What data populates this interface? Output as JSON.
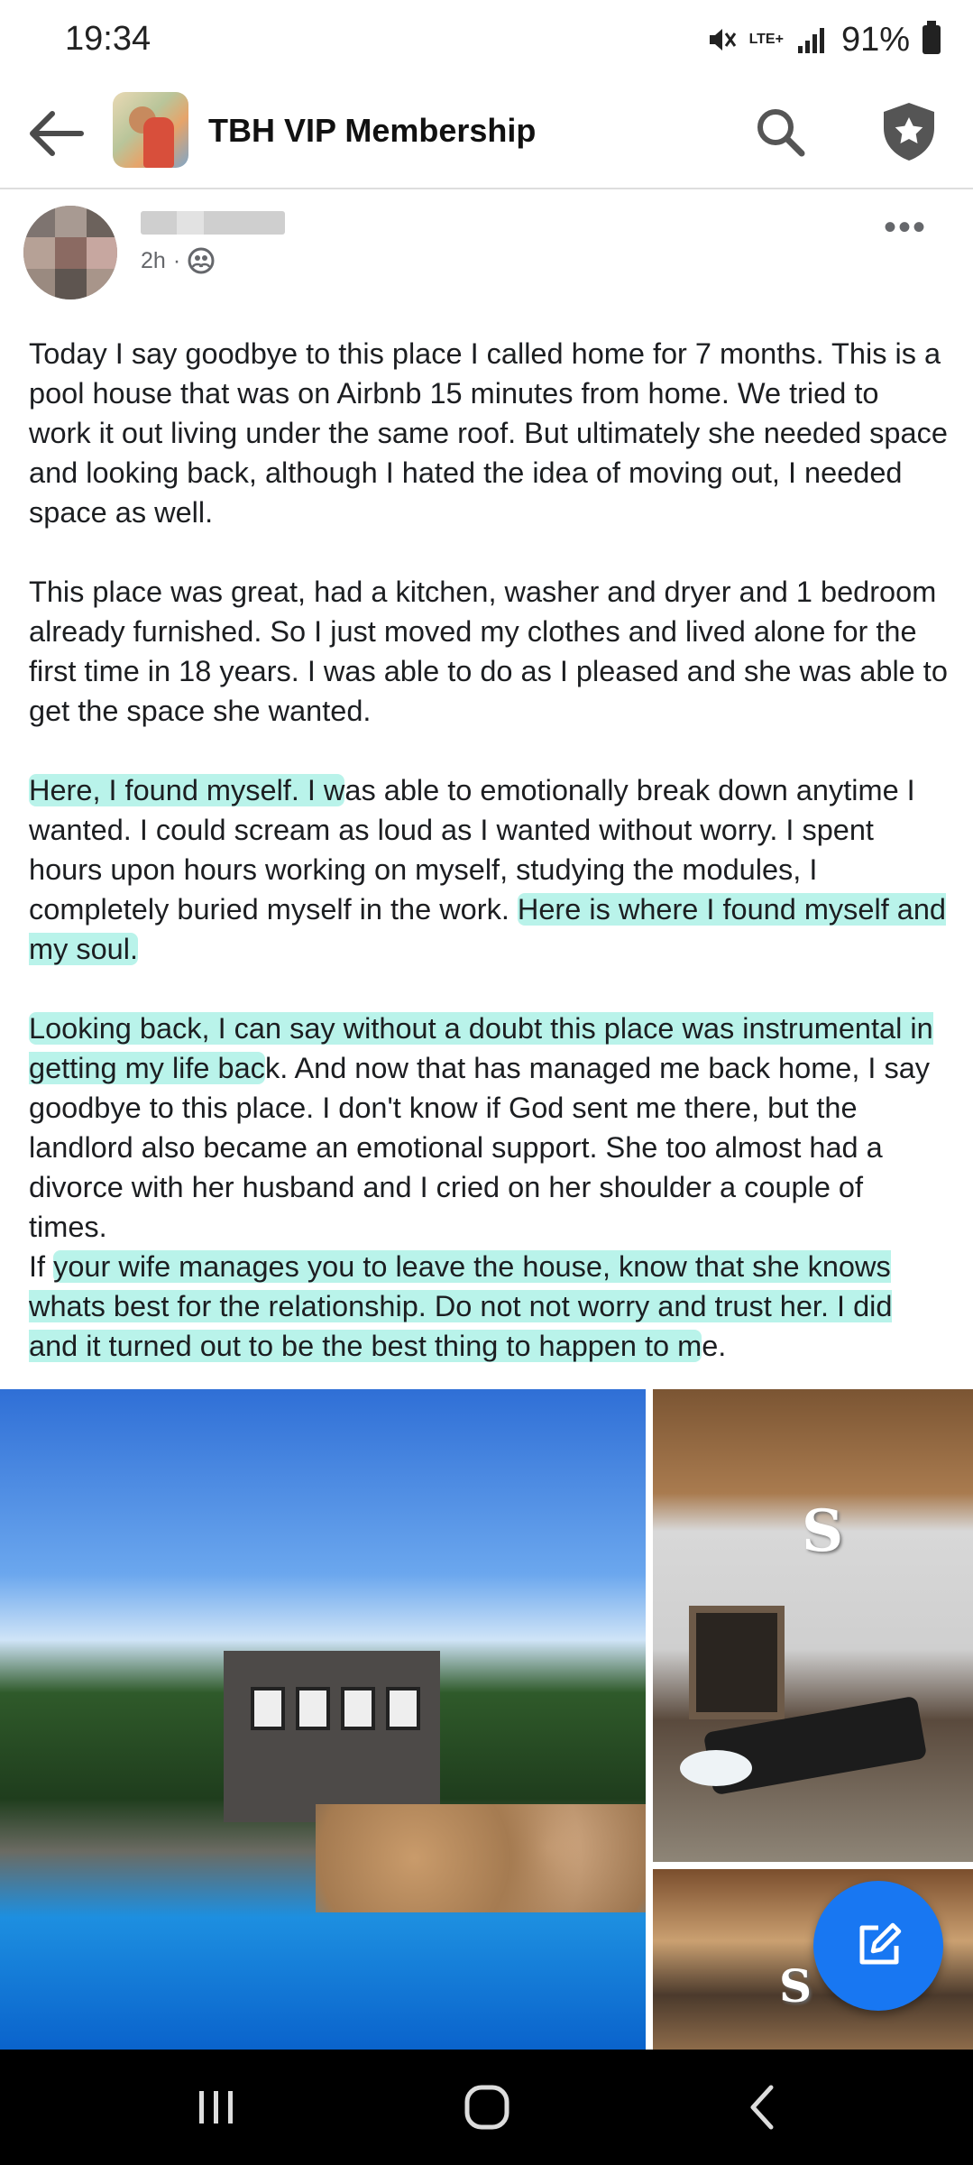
{
  "status_bar": {
    "time": "19:34",
    "network": "LTE+",
    "battery": "91%"
  },
  "app_bar": {
    "group_name": "TBH VIP Membership",
    "icons": [
      "back-arrow-icon",
      "group-avatar",
      "search-icon",
      "shield-star-icon"
    ]
  },
  "post": {
    "time": "2h",
    "privacy_icon": "group-icon",
    "paragraphs": [
      [
        {
          "text": "Today I say goodbye to this place I called home for 7 months. This is a pool house that was on Airbnb 15 minutes from home. We tried to work it out living under the same roof. But ultimately she needed space and looking back, although I hated the idea of moving out,  I needed space as well.",
          "hl": false
        }
      ],
      [
        {
          "text": "This place was great, had a kitchen, washer and dryer and 1 bedroom already furnished. So I just moved my clothes and lived alone for the first time in 18 years. I was able to do as I pleased and she was able to get the space she wanted.",
          "hl": false
        }
      ],
      [
        {
          "text": "Here, I found myself. I w",
          "hl": true
        },
        {
          "text": "as able to emotionally break down anytime I wanted. I could scream as loud as I wanted without worry. I spent hours upon hours working on myself, studying the modules, I completely buried myself in the work. ",
          "hl": false
        },
        {
          "text": "Here is where I found myself and my soul.",
          "hl": true
        }
      ],
      [
        {
          "text": "Looking back, I can say without a doubt this place was instrumental in getting my life bac",
          "hl": true
        },
        {
          "text": "k. And now that ",
          "hl": false
        },
        {
          "text": "       ",
          "hl": false,
          "redacted": true
        },
        {
          "text": "has managed me back home, I say goodbye to this place. I don't know if God sent me there, but the landlord also became an emotional support. She too almost had a divorce with her husband and I cried on her shoulder a couple of times.",
          "hl": false
        }
      ],
      [
        {
          "text": "If ",
          "hl": false
        },
        {
          "text": "your wife manages you to leave the house, know that she knows whats best for the relationship. Do not not worry and trust her. I did and it turned out to be the best thing to happen to m",
          "hl": true
        },
        {
          "text": "e.",
          "hl": false
        }
      ]
    ]
  },
  "photos": [
    "pool-house-exterior-photo",
    "living-room-photo",
    "interior-photo"
  ],
  "fab_icon": "compose-icon",
  "nav_bar": [
    "recent-apps-icon",
    "home-icon",
    "back-icon"
  ],
  "colors": {
    "highlight": "#64e4d0",
    "fab": "#1877f2",
    "meta_text": "#65676b"
  }
}
